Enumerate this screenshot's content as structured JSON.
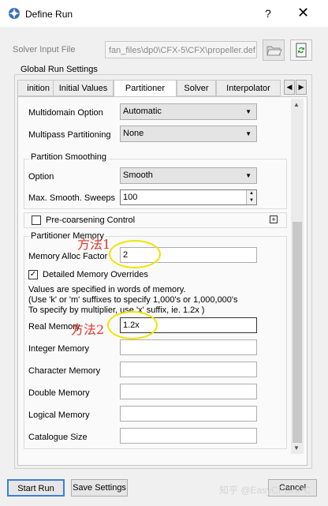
{
  "window": {
    "title": "Define Run",
    "help": "?",
    "close": "✕"
  },
  "solver": {
    "label": "Solver Input File",
    "value": "fan_files\\dp0\\CFX-5\\CFX\\propeller.def"
  },
  "group_title": "Global Run Settings",
  "tabs": [
    "inition",
    "Initial Values",
    "Partitioner",
    "Solver",
    "Interpolator"
  ],
  "multidomain": {
    "label": "Multidomain Option",
    "value": "Automatic"
  },
  "multipass": {
    "label": "Multipass Partitioning",
    "value": "None"
  },
  "smoothing": {
    "title": "Partition Smoothing",
    "option_label": "Option",
    "option_value": "Smooth",
    "sweeps_label": "Max. Smooth. Sweeps",
    "sweeps_value": "100"
  },
  "precoarsening": {
    "label": "Pre-coarsening Control",
    "expand": "+"
  },
  "memory": {
    "title": "Partitioner Memory",
    "alloc_label": "Memory Alloc Factor",
    "alloc_value": "2",
    "detailed_label": "Detailed Memory Overrides",
    "detailed_check": "✓",
    "info_1": "Values are specified in words of memory.",
    "info_2": "(Use 'k' or 'm' suffixes to specify 1,000's or 1,000,000's",
    "info_3": "To specify by multiplier, use 'x' suffix, ie. 1.2x )",
    "real_label": "Real Memory",
    "real_value": "1.2x",
    "integer_label": "Integer Memory",
    "character_label": "Character Memory",
    "double_label": "Double Memory",
    "logical_label": "Logical Memory",
    "catalogue_label": "Catalogue Size"
  },
  "annotations": {
    "method1": "方法1",
    "method2": "方法2"
  },
  "buttons": {
    "start": "Start Run",
    "save": "Save Settings",
    "cancel": "Cancel"
  },
  "watermark": "知乎 @EasyCFDHPC",
  "colors": {
    "annotation": "#e5342b",
    "highlight": "#f0e400"
  }
}
